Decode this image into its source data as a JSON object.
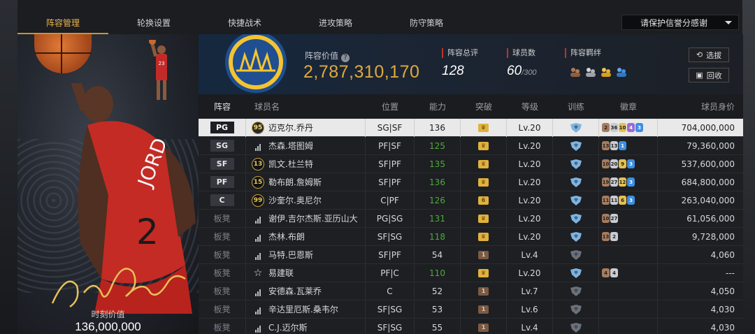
{
  "tabs": [
    {
      "label": "阵容管理",
      "active": true
    },
    {
      "label": "轮换设置",
      "active": false
    },
    {
      "label": "快捷战术",
      "active": false
    },
    {
      "label": "进攻策略",
      "active": false
    },
    {
      "label": "防守策略",
      "active": false
    }
  ],
  "dropdown": {
    "label": "请保护信誉分感谢"
  },
  "card": {
    "value_label": "时刻价值",
    "value": "136,000,000"
  },
  "summary": {
    "lineup_value_label": "阵容价值",
    "help_icon": "?",
    "lineup_value": "2,787,310,170",
    "rating_label": "阵容总评",
    "rating": "128",
    "players_label": "球员数",
    "players_count": "60",
    "players_max": "/300",
    "chemistry_label": "阵容羁绊",
    "filter_button": "选拔",
    "recycle_button": "回收"
  },
  "columns": [
    "阵容",
    "球员名",
    "位置",
    "能力",
    "突破",
    "等级",
    "训练",
    "徽章",
    "球员身价"
  ],
  "rows": [
    {
      "slot": "PG",
      "bench": false,
      "rank_icon": "badge",
      "rank": "95",
      "name": "迈克尔.乔丹",
      "position": "SG|SF",
      "ability": "136",
      "ability_color": "white",
      "breakthrough": "gold",
      "level": "Lv.20",
      "training": "blue",
      "badges": [
        [
          "bronze",
          "2"
        ],
        [
          "silver",
          "36"
        ],
        [
          "gold",
          "10"
        ],
        [
          "purple",
          "4"
        ],
        [
          "blue",
          "3"
        ]
      ],
      "value": "704,000,000",
      "selected": true
    },
    {
      "slot": "SG",
      "bench": false,
      "rank_icon": "signal",
      "rank": "",
      "name": "杰森.塔图姆",
      "position": "PF|SF",
      "ability": "125",
      "ability_color": "green",
      "breakthrough": "gold",
      "level": "Lv.20",
      "training": "blue",
      "badges": [
        [
          "bronze",
          "13"
        ],
        [
          "silver",
          "13"
        ],
        [
          "blue",
          "1"
        ]
      ],
      "value": "79,360,000",
      "selected": false
    },
    {
      "slot": "SF",
      "bench": false,
      "rank_icon": "badge",
      "rank": "13",
      "name": "凯文.杜兰特",
      "position": "SF|PF",
      "ability": "135",
      "ability_color": "green",
      "breakthrough": "gold",
      "level": "Lv.20",
      "training": "blue",
      "badges": [
        [
          "bronze",
          "10"
        ],
        [
          "silver",
          "20"
        ],
        [
          "gold",
          "9"
        ],
        [
          "blue",
          "3"
        ]
      ],
      "value": "537,600,000",
      "selected": false
    },
    {
      "slot": "PF",
      "bench": false,
      "rank_icon": "badge",
      "rank": "15",
      "name": "勒布朗.詹姆斯",
      "position": "SF|PF",
      "ability": "136",
      "ability_color": "green",
      "breakthrough": "gold",
      "level": "Lv.20",
      "training": "blue",
      "badges": [
        [
          "bronze",
          "19"
        ],
        [
          "silver",
          "27"
        ],
        [
          "gold",
          "12"
        ],
        [
          "blue",
          "3"
        ]
      ],
      "value": "684,800,000",
      "selected": false
    },
    {
      "slot": "C",
      "bench": false,
      "rank_icon": "badge",
      "rank": "99",
      "name": "沙奎尔.奥尼尔",
      "position": "C|PF",
      "ability": "126",
      "ability_color": "green",
      "breakthrough": "gold6",
      "level": "Lv.20",
      "training": "blue",
      "badges": [
        [
          "bronze",
          "11"
        ],
        [
          "silver",
          "11"
        ],
        [
          "gold",
          "6"
        ],
        [
          "blue",
          "3"
        ]
      ],
      "value": "263,040,000",
      "selected": false
    },
    {
      "slot": "板凳",
      "bench": true,
      "rank_icon": "signal",
      "rank": "",
      "name": "谢伊.吉尔杰斯.亚历山大",
      "position": "PG|SG",
      "ability": "131",
      "ability_color": "green",
      "breakthrough": "gold",
      "level": "Lv.20",
      "training": "blue",
      "badges": [
        [
          "bronze",
          "10"
        ],
        [
          "silver",
          "27"
        ]
      ],
      "value": "61,056,000",
      "selected": false
    },
    {
      "slot": "板凳",
      "bench": true,
      "rank_icon": "signal",
      "rank": "",
      "name": "杰林.布朗",
      "position": "SF|SG",
      "ability": "118",
      "ability_color": "green",
      "breakthrough": "gold",
      "level": "Lv.20",
      "training": "blue",
      "badges": [
        [
          "bronze",
          "13"
        ],
        [
          "silver",
          "2"
        ]
      ],
      "value": "9,728,000",
      "selected": false
    },
    {
      "slot": "板凳",
      "bench": true,
      "rank_icon": "signal",
      "rank": "",
      "name": "马特.巴恩斯",
      "position": "SF|PF",
      "ability": "54",
      "ability_color": "white",
      "breakthrough": "bronze",
      "level": "Lv.4",
      "training": "grey",
      "badges": [],
      "value": "4,060",
      "selected": false
    },
    {
      "slot": "板凳",
      "bench": true,
      "rank_icon": "star",
      "rank": "",
      "name": "易建联",
      "position": "PF|C",
      "ability": "110",
      "ability_color": "green",
      "breakthrough": "gold",
      "level": "Lv.20",
      "training": "blue",
      "badges": [
        [
          "bronze",
          "4"
        ],
        [
          "silver",
          "4"
        ]
      ],
      "value": "---",
      "selected": false
    },
    {
      "slot": "板凳",
      "bench": true,
      "rank_icon": "signal",
      "rank": "",
      "name": "安德森.瓦莱乔",
      "position": "C",
      "ability": "52",
      "ability_color": "white",
      "breakthrough": "bronze",
      "level": "Lv.7",
      "training": "grey",
      "badges": [],
      "value": "4,050",
      "selected": false
    },
    {
      "slot": "板凳",
      "bench": true,
      "rank_icon": "signal",
      "rank": "",
      "name": "辛达里厄斯.桑韦尔",
      "position": "SF|SG",
      "ability": "53",
      "ability_color": "white",
      "breakthrough": "bronze",
      "level": "Lv.6",
      "training": "grey",
      "badges": [],
      "value": "4,030",
      "selected": false
    },
    {
      "slot": "板凳",
      "bench": true,
      "rank_icon": "signal",
      "rank": "",
      "name": "C.J.迈尔斯",
      "position": "SF|SG",
      "ability": "55",
      "ability_color": "white",
      "breakthrough": "bronze",
      "level": "Lv.4",
      "training": "grey",
      "badges": [],
      "value": "4,030",
      "selected": false
    }
  ],
  "colors": {
    "accent": "#e0a93d",
    "ability_green": "#4dab3b",
    "stat_marker": "#c4302b"
  },
  "icons": {
    "help": "help-icon",
    "filter": "refresh-icon",
    "recycle": "recycle-icon",
    "breakthrough": "crown-icon",
    "training": "shield-icon",
    "rank": "signal-icon"
  }
}
